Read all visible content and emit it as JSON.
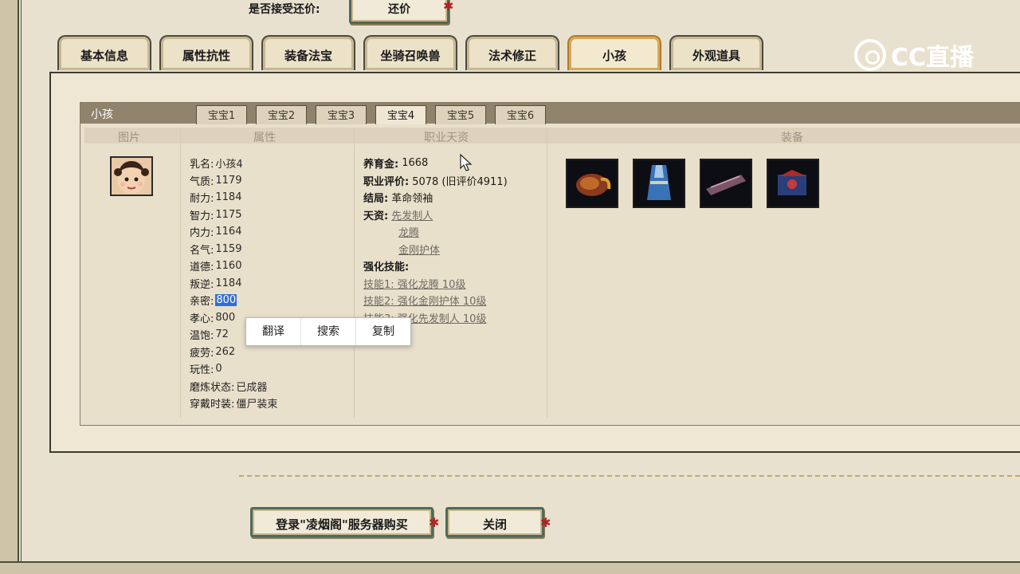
{
  "header": {
    "counter_offer_label": "是否接受还价:",
    "counter_offer_button": "还价"
  },
  "tabs": [
    {
      "label": "基本信息",
      "active": false
    },
    {
      "label": "属性抗性",
      "active": false
    },
    {
      "label": "装备法宝",
      "active": false
    },
    {
      "label": "坐骑召唤兽",
      "active": false
    },
    {
      "label": "法术修正",
      "active": false
    },
    {
      "label": "小孩",
      "active": true
    },
    {
      "label": "外观道具",
      "active": false
    }
  ],
  "watermark": {
    "text": "CC直播"
  },
  "panel": {
    "title": "小孩",
    "subtabs": [
      {
        "label": "宝宝1",
        "active": false
      },
      {
        "label": "宝宝2",
        "active": false
      },
      {
        "label": "宝宝3",
        "active": false
      },
      {
        "label": "宝宝4",
        "active": true
      },
      {
        "label": "宝宝5",
        "active": false
      },
      {
        "label": "宝宝6",
        "active": false
      }
    ],
    "columns": {
      "image": "图片",
      "attributes": "属性",
      "talent": "职业天资",
      "equipment": "装备"
    }
  },
  "attributes": [
    {
      "key": "乳名:",
      "value": "小孩4"
    },
    {
      "key": "气质:",
      "value": "1179"
    },
    {
      "key": "耐力:",
      "value": "1184"
    },
    {
      "key": "智力:",
      "value": "1175"
    },
    {
      "key": "内力:",
      "value": "1164"
    },
    {
      "key": "名气:",
      "value": "1159"
    },
    {
      "key": "道德:",
      "value": "1160"
    },
    {
      "key": "叛逆:",
      "value": "1184"
    },
    {
      "key": "亲密:",
      "value": "800"
    },
    {
      "key": "孝心:",
      "value": "800"
    },
    {
      "key": "温饱:",
      "value": "72"
    },
    {
      "key": "疲劳:",
      "value": "262"
    },
    {
      "key": "玩性:",
      "value": "0"
    },
    {
      "key": "磨炼状态:",
      "value": "已成器"
    },
    {
      "key": "穿戴时装:",
      "value": "僵尸装束"
    }
  ],
  "talent": {
    "funds_key": "养育金:",
    "funds_val": "1668",
    "rating_key": "职业评价:",
    "rating_val": "5078 (旧评价4911)",
    "ending_key": "结局:",
    "ending_val": "革命领袖",
    "aptitude_key": "天资:",
    "aptitudes": [
      "先发制人",
      "龙腾",
      "金刚护体"
    ],
    "skills_key": "强化技能:",
    "skills": [
      "技能1: 强化龙腾 10级",
      "技能2: 强化金刚护体 10级",
      "技能3: 强化先发制人 10级"
    ]
  },
  "context_menu": {
    "translate": "翻译",
    "search": "搜索",
    "copy": "复制"
  },
  "footer": {
    "login_buy": "登录\"凌烟阁\"服务器购买",
    "close": "关闭"
  },
  "colors": {
    "panel_header": "#8f836c",
    "selection": "#2f6fd6",
    "active_tab_border": "#b07a26"
  }
}
